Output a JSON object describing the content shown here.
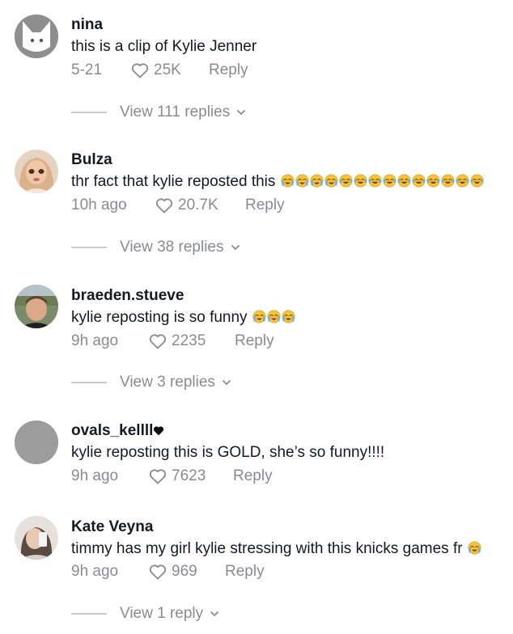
{
  "comments": [
    {
      "username": "nina",
      "text": "this is a clip of Kylie Jenner",
      "emojis": [],
      "time": "5-21",
      "likes": "25K",
      "reply_label": "Reply",
      "view_replies": "View 111 replies",
      "avatar": "cat-silhouette-avatar"
    },
    {
      "username": "Bulza",
      "text": "thr fact that kylie reposted this",
      "emojis": [
        "crying-face",
        "crying-face",
        "crying-face",
        "crying-face",
        "tears-of-joy",
        "tears-of-joy",
        "tears-of-joy",
        "tears-of-joy",
        "tears-of-joy",
        "tears-of-joy",
        "tears-of-joy",
        "tears-of-joy",
        "tears-of-joy",
        "tears-of-joy"
      ],
      "time": "10h ago",
      "likes": "20.7K",
      "reply_label": "Reply",
      "view_replies": "View 38 replies",
      "avatar": "doll-avatar"
    },
    {
      "username": "braeden.stueve",
      "text": "kylie reposting is so funny",
      "emojis": [
        "crying-face",
        "crying-face",
        "crying-face"
      ],
      "time": "9h ago",
      "likes": "2235",
      "reply_label": "Reply",
      "view_replies": "View 3 replies",
      "avatar": "photo-avatar"
    },
    {
      "username": "ovals_kellll",
      "username_emoji": "black-heart",
      "text": "kylie reposting this is GOLD, she’s so funny!!!!",
      "emojis": [],
      "time": "9h ago",
      "likes": "7623",
      "reply_label": "Reply",
      "view_replies": "",
      "avatar": "gray-default-avatar"
    },
    {
      "username": "Kate Veyna",
      "text": "timmy has my girl kylie stressing with this knicks games fr",
      "emojis": [
        "crying-face"
      ],
      "time": "9h ago",
      "likes": "969",
      "reply_label": "Reply",
      "view_replies": "View 1 reply",
      "avatar": "selfie-avatar"
    }
  ],
  "colors": {
    "primary_text": "#161823",
    "secondary_text": "#8a8b91",
    "divider": "#c9cacd",
    "default_avatar": "#9c9c9c"
  }
}
